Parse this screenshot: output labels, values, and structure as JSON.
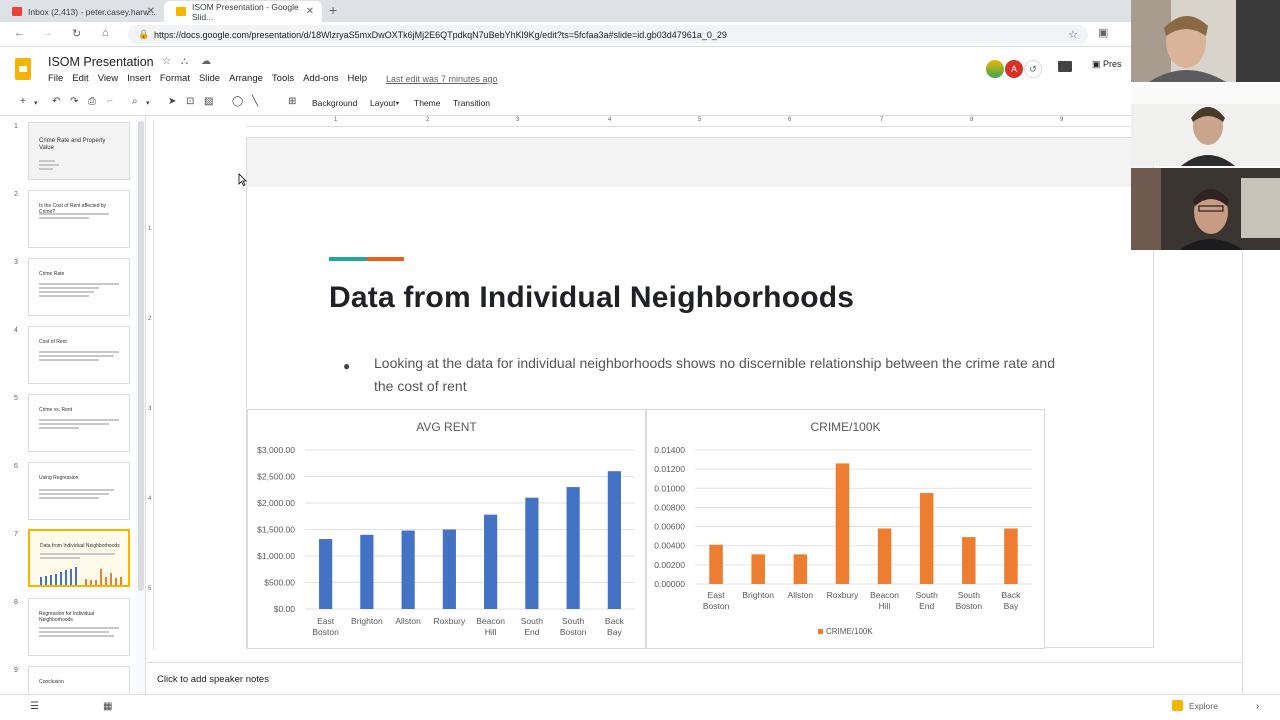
{
  "browser": {
    "tabs": [
      {
        "title": "Inbox (2,413) - peter.casey.harw..."
      },
      {
        "title": "ISOM Presentation - Google Slid..."
      }
    ],
    "url": "https://docs.google.com/presentation/d/18WlzryaS5mxDwOXTk6jMj2E6QTpdkqN7uBebYhKl9Kg/edit?ts=5fcfaa3a#slide=id.gb03d47961a_0_29"
  },
  "app": {
    "title": "ISOM Presentation",
    "menu": [
      "File",
      "Edit",
      "View",
      "Insert",
      "Format",
      "Slide",
      "Arrange",
      "Tools",
      "Add-ons",
      "Help"
    ],
    "last_edit": "Last edit was 7 minutes ago",
    "avatar_letter": "A",
    "present_label": "Pres"
  },
  "toolbar": {
    "background": "Background",
    "layout": "Layout",
    "theme": "Theme",
    "transition": "Transition"
  },
  "filmstrip": {
    "thumbnails": [
      {
        "num": "1",
        "title": "Crime Rate and Property Value"
      },
      {
        "num": "2",
        "title": "Is the Cost of Rent affected by Crime?"
      },
      {
        "num": "3",
        "title": "Crime Rate"
      },
      {
        "num": "4",
        "title": "Cost of Rent"
      },
      {
        "num": "5",
        "title": "Crime vs. Rent"
      },
      {
        "num": "6",
        "title": "Using Regression"
      },
      {
        "num": "7",
        "title": "Data from Individual Neighborhoods"
      },
      {
        "num": "8",
        "title": "Regression for Individual Neighborhoods"
      },
      {
        "num": "9",
        "title": "Conclusion"
      }
    ]
  },
  "ruler": {
    "h_ticks": [
      "1",
      "2",
      "3",
      "4",
      "5",
      "6",
      "7",
      "8",
      "9"
    ],
    "v_ticks": [
      "1",
      "2",
      "3",
      "4",
      "5"
    ]
  },
  "slide": {
    "title": "Data from Individual Neighborhoods",
    "bullet": "Looking at the data for individual neighborhoods shows no discernible relationship between the crime rate and the cost of rent"
  },
  "chart_data": [
    {
      "type": "bar",
      "title": "AVG RENT",
      "categories": [
        "East Boston",
        "Brighton",
        "Allston",
        "Roxbury",
        "Beacon Hill",
        "South End",
        "South Boston",
        "Back Bay"
      ],
      "values": [
        1320,
        1400,
        1480,
        1500,
        1780,
        2100,
        2300,
        2600
      ],
      "ylim": [
        0,
        3000
      ],
      "yticks": [
        "$3,000.00",
        "$2,500.00",
        "$2,000.00",
        "$1,500.00",
        "$1,000.00",
        "$500.00",
        "$0.00"
      ],
      "color": "#4472c4",
      "grid": true
    },
    {
      "type": "bar",
      "title": "CRIME/100K",
      "categories": [
        "East Boston",
        "Brighton",
        "Allston",
        "Roxbury",
        "Beacon Hill",
        "South End",
        "South Boston",
        "Back Bay"
      ],
      "values": [
        0.0041,
        0.0031,
        0.0031,
        0.0126,
        0.0058,
        0.0095,
        0.0049,
        0.0058
      ],
      "ylim": [
        0,
        0.014
      ],
      "yticks": [
        "0.01400",
        "0.01200",
        "0.01000",
        "0.00800",
        "0.00600",
        "0.00400",
        "0.00200",
        "0.00000"
      ],
      "series": [
        {
          "name": "CRIME/100K"
        }
      ],
      "color": "#ed7d31",
      "grid": true,
      "legend": "bottom"
    }
  ],
  "notes": {
    "placeholder": "Click to add speaker notes"
  },
  "bottom": {
    "explore": "Explore"
  }
}
